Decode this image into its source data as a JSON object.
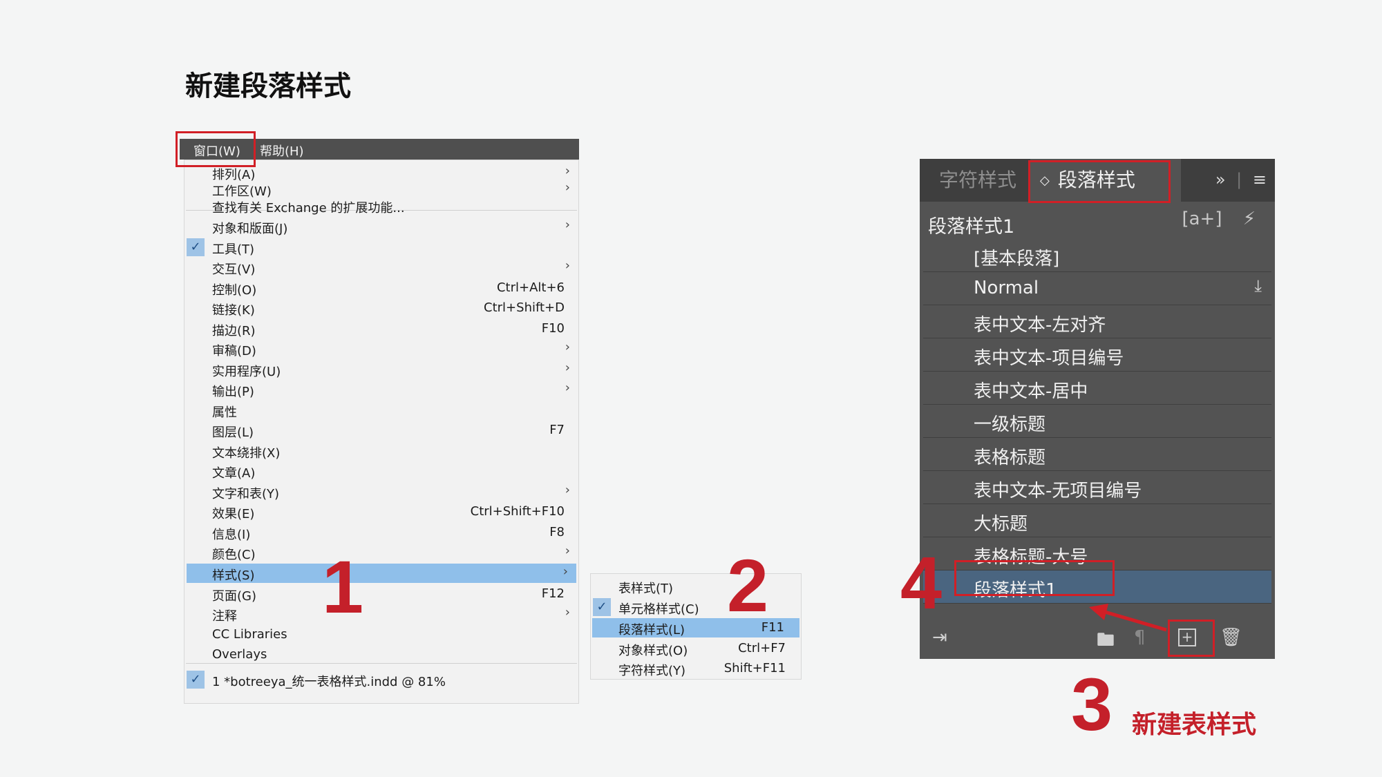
{
  "page_title": "新建段落样式",
  "menubar": {
    "window": "窗口(W)",
    "help": "帮助(H)"
  },
  "window_menu": {
    "items": [
      {
        "label": "排列(A)",
        "shortcut": "",
        "submenu": true,
        "checked": false
      },
      {
        "label": "工作区(W)",
        "shortcut": "",
        "submenu": true,
        "checked": false
      },
      {
        "label": "查找有关 Exchange 的扩展功能...",
        "shortcut": "",
        "submenu": false,
        "checked": false
      },
      {
        "label": "对象和版面(J)",
        "shortcut": "",
        "submenu": true,
        "checked": false
      },
      {
        "label": "工具(T)",
        "shortcut": "",
        "submenu": false,
        "checked": true
      },
      {
        "label": "交互(V)",
        "shortcut": "",
        "submenu": true,
        "checked": false
      },
      {
        "label": "控制(O)",
        "shortcut": "Ctrl+Alt+6",
        "submenu": false,
        "checked": false
      },
      {
        "label": "链接(K)",
        "shortcut": "Ctrl+Shift+D",
        "submenu": false,
        "checked": false
      },
      {
        "label": "描边(R)",
        "shortcut": "F10",
        "submenu": false,
        "checked": false
      },
      {
        "label": "审稿(D)",
        "shortcut": "",
        "submenu": true,
        "checked": false
      },
      {
        "label": "实用程序(U)",
        "shortcut": "",
        "submenu": true,
        "checked": false
      },
      {
        "label": "输出(P)",
        "shortcut": "",
        "submenu": true,
        "checked": false
      },
      {
        "label": "属性",
        "shortcut": "",
        "submenu": false,
        "checked": false
      },
      {
        "label": "图层(L)",
        "shortcut": "F7",
        "submenu": false,
        "checked": false
      },
      {
        "label": "文本绕排(X)",
        "shortcut": "",
        "submenu": false,
        "checked": false
      },
      {
        "label": "文章(A)",
        "shortcut": "",
        "submenu": false,
        "checked": false
      },
      {
        "label": "文字和表(Y)",
        "shortcut": "",
        "submenu": true,
        "checked": false
      },
      {
        "label": "效果(E)",
        "shortcut": "Ctrl+Shift+F10",
        "submenu": false,
        "checked": false
      },
      {
        "label": "信息(I)",
        "shortcut": "F8",
        "submenu": false,
        "checked": false
      },
      {
        "label": "颜色(C)",
        "shortcut": "",
        "submenu": true,
        "checked": false
      },
      {
        "label": "样式(S)",
        "shortcut": "",
        "submenu": true,
        "checked": false,
        "highlighted": true
      },
      {
        "label": "页面(G)",
        "shortcut": "F12",
        "submenu": false,
        "checked": false
      },
      {
        "label": "注释",
        "shortcut": "",
        "submenu": true,
        "checked": false
      },
      {
        "label": "CC Libraries",
        "shortcut": "",
        "submenu": false,
        "checked": false
      },
      {
        "label": "Overlays",
        "shortcut": "",
        "submenu": false,
        "checked": false
      },
      {
        "label": "1 *botreeya_统一表格样式.indd @ 81%",
        "shortcut": "",
        "submenu": false,
        "checked": true
      }
    ]
  },
  "styles_submenu": {
    "items": [
      {
        "label": "表样式(T)",
        "shortcut": "",
        "checked": false
      },
      {
        "label": "单元格样式(C)",
        "shortcut": "",
        "checked": true
      },
      {
        "label": "段落样式(L)",
        "shortcut": "F11",
        "checked": false,
        "highlighted": true
      },
      {
        "label": "对象样式(O)",
        "shortcut": "Ctrl+F7",
        "checked": false
      },
      {
        "label": "字符样式(Y)",
        "shortcut": "Shift+F11",
        "checked": false
      }
    ]
  },
  "panel": {
    "tab_char": "字符样式",
    "tab_para": "段落样式",
    "tab_para_updown": "◇",
    "current_style": "段落样式1",
    "styles": [
      {
        "name": "[基本段落]"
      },
      {
        "name": "Normal",
        "icon": "import-icon"
      },
      {
        "name": "表中文本-左对齐"
      },
      {
        "name": "表中文本-项目编号"
      },
      {
        "name": "表中文本-居中"
      },
      {
        "name": "一级标题"
      },
      {
        "name": "表格标题"
      },
      {
        "name": "表中文本-无项目编号"
      },
      {
        "name": "大标题"
      },
      {
        "name": "表格标题-大号"
      },
      {
        "name": "段落样式1",
        "selected": true
      }
    ]
  },
  "annotations": {
    "step1": "1",
    "step2": "2",
    "step3": "3",
    "step4": "4",
    "step3_caption": "新建表样式"
  },
  "colors": {
    "accent_red": "#d11f26",
    "menu_highlight": "#8fbfea",
    "panel_bg": "#535353",
    "panel_selected": "#4a6580"
  }
}
